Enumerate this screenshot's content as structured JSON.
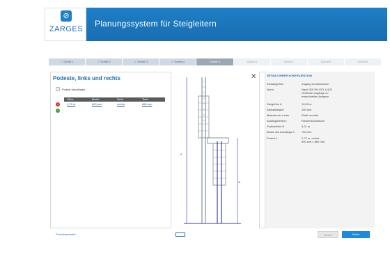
{
  "header": {
    "logo_text": "ZARGES",
    "title": "Planungssystem für Steigleitern",
    "brand_color": "#1d7fc6",
    "logo_icon": "zarges-mark-icon"
  },
  "steps": [
    {
      "label": "✓ Schritt 1",
      "state": "done"
    },
    {
      "label": "✓ Schritt 2",
      "state": "done"
    },
    {
      "label": "✓ Schritt 3",
      "state": "done"
    },
    {
      "label": "✓ Schritt 4",
      "state": "done"
    },
    {
      "label": "Schritt 5",
      "state": "active"
    },
    {
      "label": "Schritt 6",
      "state": "todo"
    },
    {
      "label": "Schritt 7",
      "state": "todo"
    },
    {
      "label": "Schritt 8",
      "state": "todo"
    },
    {
      "label": "Schritt 9",
      "state": "todo"
    }
  ],
  "left": {
    "title": "Podeste, links und rechts",
    "add_podest": "Podest hinzufügen",
    "columns": [
      "Höhe",
      "Breite",
      "Seite",
      "Tiefe"
    ],
    "row": {
      "height": "2,72 m",
      "width": "600 mm",
      "side": "rechts",
      "depth": "860 mm"
    }
  },
  "drawing": {
    "close_icon": "close-icon"
  },
  "details": {
    "title": "DETAILS IHRER KONFIGURATION",
    "rows": [
      {
        "label": "Einsatzgebiet",
        "value": "Zugang zu Maschinen"
      },
      {
        "label": "Norm",
        "value": "Nach DIN EN ISO 14122\nOrtsfeste Zugänge zu\nmaschinellen Anlagen"
      },
      {
        "label": "Steighöhe A",
        "value": "10,00 m"
      },
      {
        "label": "Wandabstand",
        "value": "200 mm"
      },
      {
        "label": "Material der Leiter",
        "value": "Stahl verzinkt"
      },
      {
        "label": "Austiegsbereich",
        "value": "Rückenschutzkorb"
      },
      {
        "label": "Podesthöhe B",
        "value": "5,21 m"
      },
      {
        "label": "Breite des Ausstiegs C",
        "value": "700 mm"
      },
      {
        "label": "Podest 1",
        "value": "2,72 m, rechts\n600 mm x 860 mm"
      }
    ]
  },
  "footer": {
    "product_link": "Produktauswahl",
    "back_label": "Zurück",
    "next_label": "Weiter",
    "view_icon": "view-toggle-icon"
  }
}
